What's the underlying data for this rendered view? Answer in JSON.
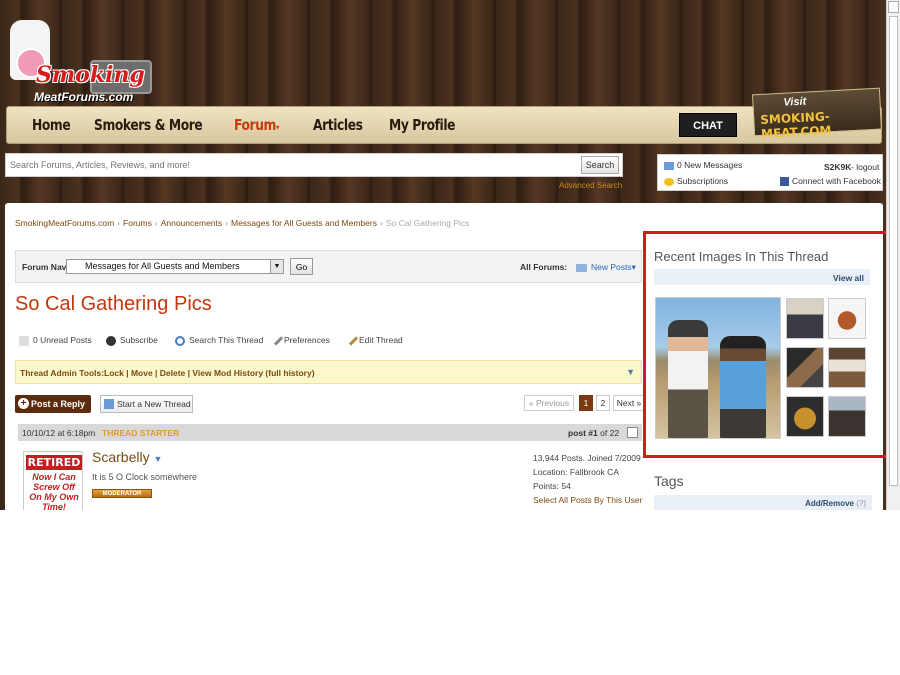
{
  "logo": {
    "line1": "Smoking",
    "line2": "MeatForums.com"
  },
  "nav": {
    "items": [
      "Home",
      "Smokers & More",
      "Forum",
      "Articles",
      "My Profile"
    ],
    "active_caret": "▾",
    "chat": "CHAT",
    "visit_line1": "Visit",
    "visit_line2": "SMOKING-MEAT.COM"
  },
  "search": {
    "placeholder": "Search Forums, Articles, Reviews, and more!",
    "button": "Search",
    "advanced": "Advanced Search"
  },
  "userbox": {
    "messages": "0 New Messages",
    "subscriptions": "Subscriptions",
    "username": "S2K9K",
    "logout": "logout",
    "facebook": "Connect with Facebook"
  },
  "breadcrumb": {
    "items": [
      "SmokingMeatForums.com",
      "Forums",
      "Announcements",
      "Messages for All Guests and Members"
    ],
    "current": "So Cal Gathering Pics",
    "separator": "›"
  },
  "forum_nav": {
    "label": "Forum Nav:",
    "selected": "Messages for All Guests and Members",
    "go": "Go",
    "all_forums": "All Forums:",
    "new_posts": "New Posts"
  },
  "thread": {
    "title": "So Cal Gathering Pics",
    "actions": [
      "0 Unread Posts",
      "Subscribe",
      "Search This Thread",
      "Preferences",
      "Edit Thread"
    ]
  },
  "admin_tools": {
    "label": "Thread Admin Tools:",
    "links": "Lock | Move | Delete | View Mod History (full history)"
  },
  "buttons": {
    "post_reply": "Post a Reply",
    "new_thread": "Start a New Thread"
  },
  "pagination": {
    "previous": "« Previous",
    "pages": [
      "1",
      "2"
    ],
    "next": "Next »"
  },
  "post": {
    "date": "10/10/12 at 6:18pm",
    "starter": "THREAD STARTER",
    "post_label": "post #1",
    "of_label": "of 22",
    "username": "Scarbelly",
    "user_title": "It is 5 O Clock somewhere",
    "badge": "MODERATOR",
    "avatar_line1": "RETIRED",
    "avatar_line2": "Now I Can Screw Off On My Own Time!",
    "stats": {
      "posts": "13,944 Posts. Joined 7/2009",
      "location": "Location: Fallbrook CA",
      "points": "Points: 54",
      "select": "Select All Posts By This User"
    }
  },
  "sidebar": {
    "recent_images_title": "Recent Images In This Thread",
    "view_all": "View all",
    "tags_title": "Tags",
    "add_remove": "Add/Remove",
    "help": "(?)"
  },
  "colors": {
    "accent": "#c4360e",
    "link": "#7b4a12",
    "highlight": "#d11c1c"
  }
}
